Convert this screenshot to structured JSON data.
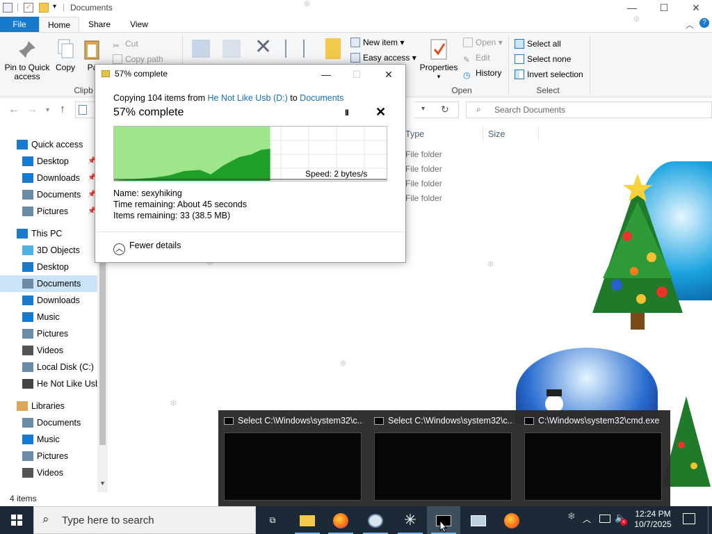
{
  "window": {
    "title": "Documents",
    "controls": {
      "minimize": "—",
      "maximize": "☐",
      "close": "✕"
    }
  },
  "ribbon": {
    "tabs": {
      "file": "File",
      "home": "Home",
      "share": "Share",
      "view": "View"
    },
    "clipboard": {
      "pin": "Pin to Quick access",
      "copy": "Copy",
      "paste": "Pa",
      "cut": "Cut",
      "copy_path": "Copy path",
      "group_label": "Clipb"
    },
    "new_item": "New item",
    "easy_access": "Easy access",
    "open_group": {
      "properties": "Properties",
      "open": "Open",
      "edit": "Edit",
      "history": "History",
      "group_label": "Open"
    },
    "select_group": {
      "select_all": "Select all",
      "select_none": "Select none",
      "invert": "Invert selection",
      "group_label": "Select"
    }
  },
  "search": {
    "placeholder": "Search Documents"
  },
  "nav": {
    "items": [
      {
        "label": "Quick access",
        "kind": "star",
        "indent": 0,
        "pinned": false
      },
      {
        "label": "Desktop",
        "kind": "desktop",
        "indent": 1,
        "pinned": true
      },
      {
        "label": "Downloads",
        "kind": "download",
        "indent": 1,
        "pinned": true
      },
      {
        "label": "Documents",
        "kind": "doc",
        "indent": 1,
        "pinned": true
      },
      {
        "label": "Pictures",
        "kind": "pic",
        "indent": 1,
        "pinned": true
      },
      {
        "label": "This PC",
        "kind": "pc",
        "indent": 0,
        "pinned": false
      },
      {
        "label": "3D Objects",
        "kind": "3d",
        "indent": 1,
        "pinned": false
      },
      {
        "label": "Desktop",
        "kind": "desktop",
        "indent": 1,
        "pinned": false
      },
      {
        "label": "Documents",
        "kind": "doc",
        "indent": 1,
        "pinned": false,
        "selected": true
      },
      {
        "label": "Downloads",
        "kind": "download",
        "indent": 1,
        "pinned": false
      },
      {
        "label": "Music",
        "kind": "music",
        "indent": 1,
        "pinned": false
      },
      {
        "label": "Pictures",
        "kind": "pic",
        "indent": 1,
        "pinned": false
      },
      {
        "label": "Videos",
        "kind": "video",
        "indent": 1,
        "pinned": false
      },
      {
        "label": "Local Disk (C:)",
        "kind": "disk",
        "indent": 1,
        "pinned": false
      },
      {
        "label": "He Not Like Usb",
        "kind": "usb",
        "indent": 1,
        "pinned": false
      },
      {
        "label": "Libraries",
        "kind": "lib",
        "indent": 0,
        "pinned": false
      },
      {
        "label": "Documents",
        "kind": "doc",
        "indent": 1,
        "pinned": false
      },
      {
        "label": "Music",
        "kind": "music",
        "indent": 1,
        "pinned": false
      },
      {
        "label": "Pictures",
        "kind": "pic",
        "indent": 1,
        "pinned": false
      },
      {
        "label": "Videos",
        "kind": "video",
        "indent": 1,
        "pinned": false
      }
    ]
  },
  "file_list": {
    "headers": {
      "type": "Type",
      "size": "Size"
    },
    "rows": [
      "File folder",
      "File folder",
      "File folder",
      "File folder"
    ]
  },
  "status": {
    "items": "4 items"
  },
  "copy_dialog": {
    "title": "57% complete",
    "percent": 57,
    "copy_prefix": "Copying 104 items from ",
    "source": "He Not Like Usb (D:)",
    "to": " to ",
    "destination": "Documents",
    "progress_text": "57% complete",
    "pause": "II",
    "cancel": "✕",
    "speed": "Speed: 2 bytes/s",
    "name": "Name:  sexyhiking",
    "time_remaining": "Time remaining:  About 45 seconds",
    "items_remaining": "Items remaining:  33 (38.5 MB)",
    "fewer_details": "Fewer details"
  },
  "thumbnails": [
    {
      "title": "Select C:\\Windows\\system32\\c..."
    },
    {
      "title": "Select C:\\Windows\\system32\\c..."
    },
    {
      "title": "C:\\Windows\\system32\\cmd.exe"
    }
  ],
  "taskbar": {
    "search_placeholder": "Type here to search",
    "time": "12:24 PM",
    "date": "10/7/2025",
    "accent": "#76b9ed"
  },
  "colors": {
    "file_tab": "#1979ca",
    "progress_fill": "#9ee68a",
    "progress_area": "#1f9f2a",
    "selection": "#cce4f7"
  }
}
